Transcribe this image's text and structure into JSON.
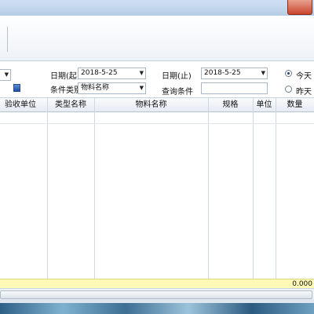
{
  "filter": {
    "date_start_label": "日期(起)",
    "date_start_value": "2018-5-25",
    "date_end_label": "日期(止)",
    "date_end_value": "2018-5-25",
    "condition_type_label": "条件类别",
    "condition_type_value": "物料名称",
    "query_label": "查询条件",
    "query_value": "",
    "radio_today_label": "今天",
    "radio_yesterday_label": "昨天"
  },
  "grid": {
    "columns": [
      "验收单位",
      "类型名称",
      "物料名称",
      "规格",
      "单位",
      "数量"
    ],
    "rows": [],
    "summary_quantity": "0.000"
  }
}
